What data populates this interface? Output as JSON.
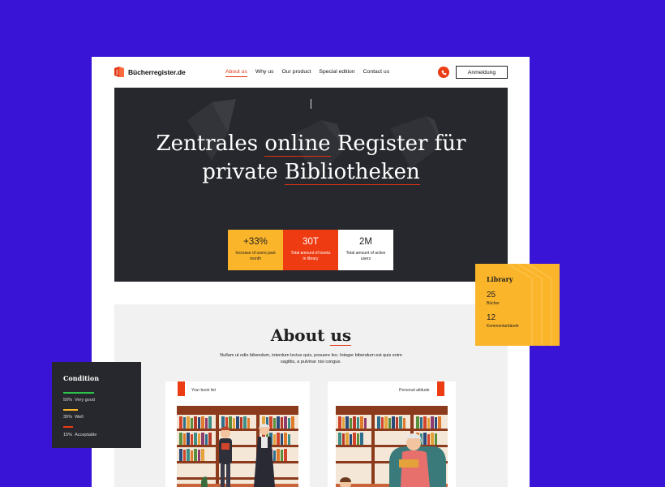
{
  "brand": {
    "name": "Bücherregister.de",
    "accent": "#e33412",
    "background": "#3a14d6"
  },
  "nav": {
    "items": [
      {
        "label": "About us",
        "active": true
      },
      {
        "label": "Why us",
        "active": false
      },
      {
        "label": "Our product",
        "active": false
      },
      {
        "label": "Special edition",
        "active": false
      },
      {
        "label": "Contact us",
        "active": false
      }
    ],
    "phone_icon": "phone-icon",
    "login_label": "Anmeldung"
  },
  "hero": {
    "line1_pre": "Zentrales ",
    "line1_u": "online",
    "line1_post": " Register für",
    "line2_pre": "private ",
    "line2_u": "Bibliotheken",
    "stats": [
      {
        "value": "+33%",
        "label": "Increase of users past month"
      },
      {
        "value": "30T",
        "label": "Total amount of books in library"
      },
      {
        "value": "2M",
        "label": "Total amount of active users"
      }
    ]
  },
  "about": {
    "title_pre": "About ",
    "title_u": "us",
    "text": "Nullam ut odio bibendum, interdum lectus quis, posuere leo. Integer bibendum est quis enim sagittis, a pulvinar nisi congue.",
    "cards": [
      {
        "caption": "Your book list"
      },
      {
        "caption": "Personal attitude"
      }
    ]
  },
  "condition": {
    "title": "Condition",
    "rows": [
      {
        "percent": "50%",
        "label": "Very good",
        "color": "#2ec24a"
      },
      {
        "percent": "35%",
        "label": "Well",
        "color": "#fbb52a"
      },
      {
        "percent": "15%",
        "label": "Acceptable",
        "color": "#ec3c13"
      }
    ]
  },
  "library": {
    "title": "Library",
    "stats": [
      {
        "value": "25",
        "label": "Bücher"
      },
      {
        "value": "12",
        "label": "Kommentarbände"
      }
    ]
  }
}
